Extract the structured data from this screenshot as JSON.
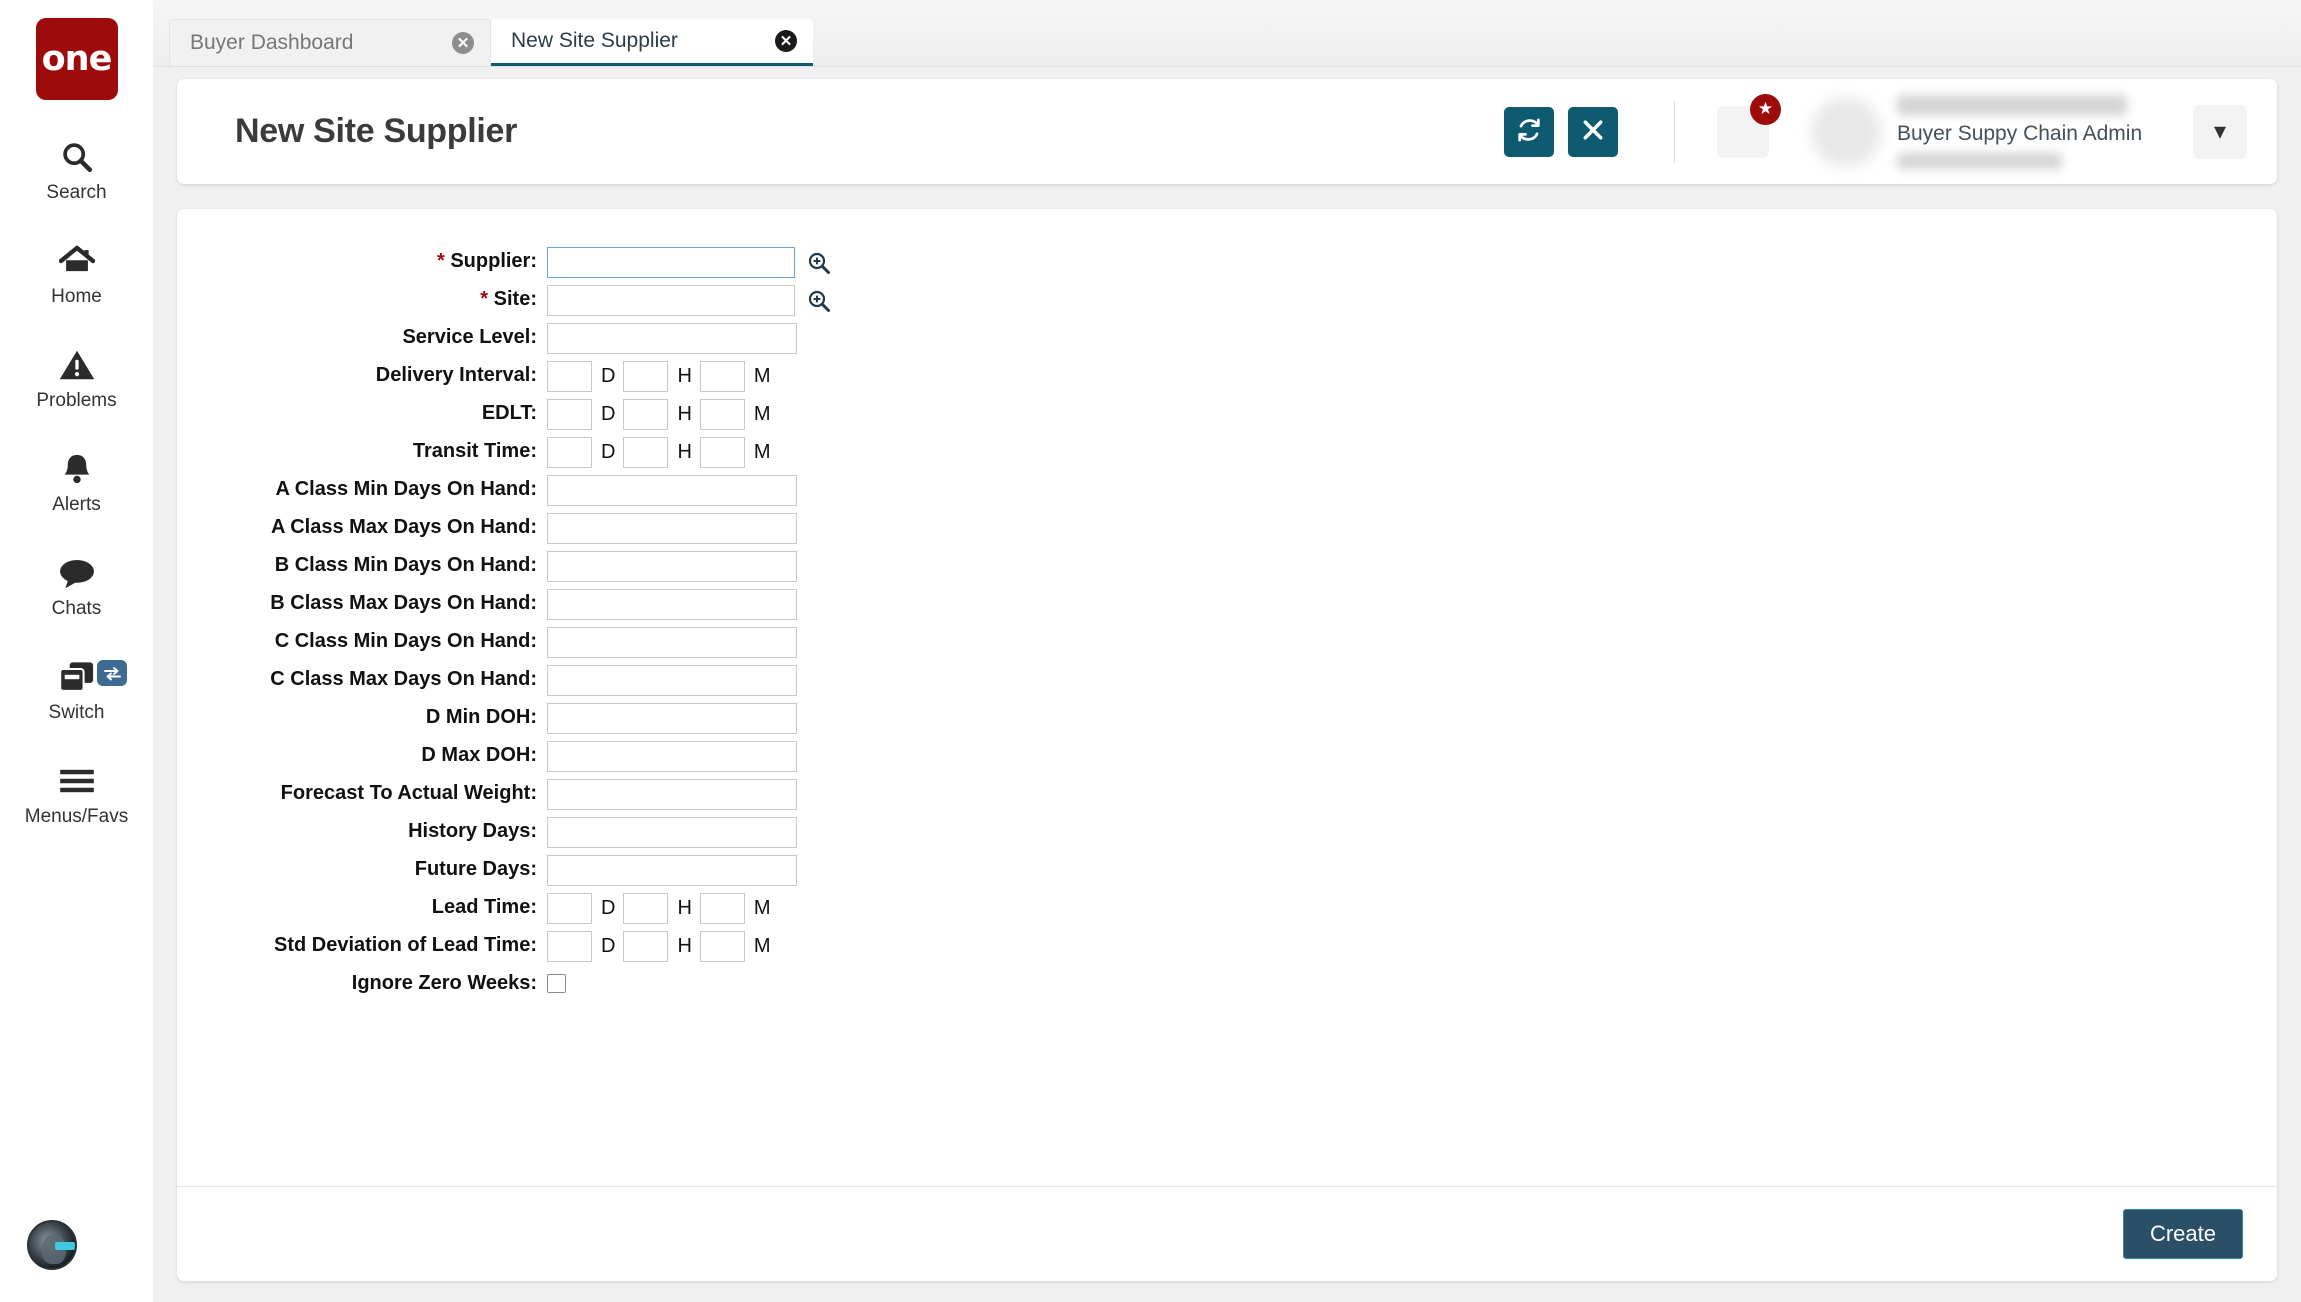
{
  "brand": {
    "logo_text": "one",
    "logo_color": "#9e0b0b"
  },
  "theme": {
    "accent_teal": "#0e5a70",
    "create_button_bg": "#2b4f66",
    "create_button_border": "#2e8ba0",
    "badge_red": "#9e0b0b",
    "switch_badge_blue": "#3d6b91"
  },
  "sidebar": {
    "items": [
      {
        "label": "Search",
        "icon": "search-icon"
      },
      {
        "label": "Home",
        "icon": "home-icon"
      },
      {
        "label": "Problems",
        "icon": "warning-triangle-icon"
      },
      {
        "label": "Alerts",
        "icon": "bell-icon"
      },
      {
        "label": "Chats",
        "icon": "chat-bubble-icon"
      },
      {
        "label": "Switch",
        "icon": "switch-cards-icon",
        "badge_icon": "swap-arrows-icon"
      },
      {
        "label": "Menus/Favs",
        "icon": "hamburger-icon"
      }
    ],
    "bottom_avatar_icon": "ai-assistant-icon"
  },
  "tabs": [
    {
      "label": "Buyer Dashboard",
      "active": false,
      "close_icon": "close-circle-icon"
    },
    {
      "label": "New Site Supplier",
      "active": true,
      "close_icon": "close-circle-icon"
    }
  ],
  "header": {
    "title": "New Site Supplier",
    "refresh_icon": "refresh-icon",
    "close_icon": "close-x-icon",
    "menu_favs_icon": "menu-list-icon",
    "favorites_badge_icon": "star-icon",
    "avatar_icon": "user-avatar",
    "user_name": "",
    "user_role": "Buyer Suppy Chain Admin",
    "user_sub": "",
    "dropdown_icon": "chevron-down-icon"
  },
  "form": {
    "lookup_icon": "magnifier-plus-icon",
    "fields": [
      {
        "label": "Supplier:",
        "required": true,
        "type": "lookup",
        "value": "",
        "focused": true
      },
      {
        "label": "Site:",
        "required": true,
        "type": "lookup",
        "value": "",
        "focused": false
      },
      {
        "label": "Service Level:",
        "required": false,
        "type": "text",
        "value": ""
      },
      {
        "label": "Delivery Interval:",
        "required": false,
        "type": "duration",
        "d": "",
        "h": "",
        "m": ""
      },
      {
        "label": "EDLT:",
        "required": false,
        "type": "duration",
        "d": "",
        "h": "",
        "m": ""
      },
      {
        "label": "Transit Time:",
        "required": false,
        "type": "duration",
        "d": "",
        "h": "",
        "m": ""
      },
      {
        "label": "A Class Min Days On Hand:",
        "required": false,
        "type": "text",
        "value": ""
      },
      {
        "label": "A Class Max Days On Hand:",
        "required": false,
        "type": "text",
        "value": ""
      },
      {
        "label": "B Class Min Days On Hand:",
        "required": false,
        "type": "text",
        "value": ""
      },
      {
        "label": "B Class Max Days On Hand:",
        "required": false,
        "type": "text",
        "value": ""
      },
      {
        "label": "C Class Min Days On Hand:",
        "required": false,
        "type": "text",
        "value": ""
      },
      {
        "label": "C Class Max Days On Hand:",
        "required": false,
        "type": "text",
        "value": ""
      },
      {
        "label": "D Min DOH:",
        "required": false,
        "type": "text",
        "value": ""
      },
      {
        "label": "D Max DOH:",
        "required": false,
        "type": "text",
        "value": ""
      },
      {
        "label": "Forecast To Actual Weight:",
        "required": false,
        "type": "text",
        "value": ""
      },
      {
        "label": "History Days:",
        "required": false,
        "type": "text",
        "value": ""
      },
      {
        "label": "Future Days:",
        "required": false,
        "type": "text",
        "value": ""
      },
      {
        "label": "Lead Time:",
        "required": false,
        "type": "duration",
        "d": "",
        "h": "",
        "m": ""
      },
      {
        "label": "Std Deviation of Lead Time:",
        "required": false,
        "type": "duration",
        "d": "",
        "h": "",
        "m": ""
      },
      {
        "label": "Ignore Zero Weeks:",
        "required": false,
        "type": "checkbox",
        "checked": false
      }
    ],
    "duration_units": {
      "days": "D",
      "hours": "H",
      "minutes": "M"
    },
    "submit_label": "Create"
  }
}
